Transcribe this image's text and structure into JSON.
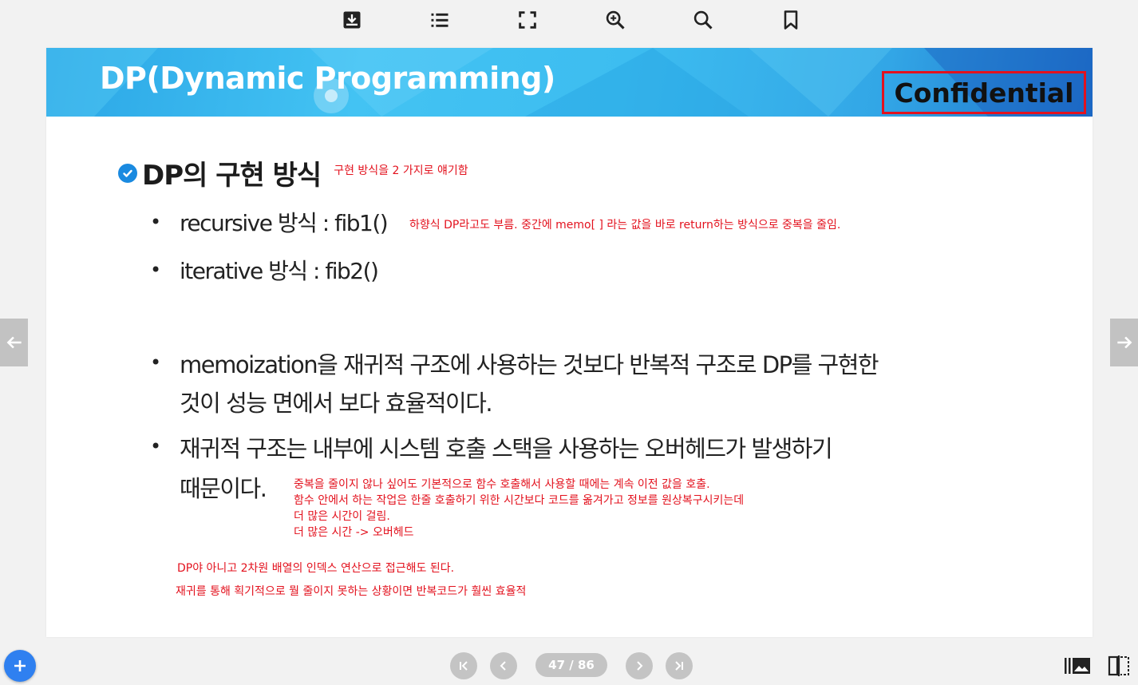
{
  "toolbar": {
    "icons": [
      "download-icon",
      "list-icon",
      "fullscreen-icon",
      "zoom-in-icon",
      "search-icon",
      "bookmark-icon"
    ]
  },
  "slide": {
    "banner_title": "DP(Dynamic Programming)",
    "confidential": "Confidential",
    "heading": "DP의 구현 방식",
    "heading_note": "구현 방식을 2 가지로 얘기함",
    "bullets": [
      {
        "text": "recursive 방식 : fib1()"
      },
      {
        "text": "iterative 방식 : fib2()"
      },
      {
        "line1": "memoization을 재귀적 구조에 사용하는 것보다 반복적 구조로 DP를 구현한",
        "line2": "것이 성능 면에서 보다 효율적이다."
      },
      {
        "line1": "재귀적 구조는 내부에 시스템 호출 스택을 사용하는 오버헤드가 발생하기",
        "line2": "때문이다."
      }
    ],
    "notes": {
      "recursive_note": "하향식 DP라고도 부름. 중간에 memo[ ] 라는 값을 바로 return하는 방식으로 중복을 줄임.",
      "overhead_lines": [
        "중복을 줄이지 않나 싶어도 기본적으로 함수 호출해서 사용할 때에는 계속 이전 값을 호출.",
        "함수 안에서 하는 작업은 한줄 호출하기 위한 시간보다 코드를 옮겨가고 정보를 원상복구시키는데",
        "더 많은 시간이 걸림.",
        "더 많은 시간 -> 오버헤드"
      ],
      "bottom_1": "DP야 아니고 2차원 배열의 인덱스 연산으로 접근해도 된다.",
      "bottom_2": "재귀를 통해 획기적으로 뭘 줄이지 못하는 상황이면 반복코드가 훨씬 효율적"
    }
  },
  "navigation": {
    "page_counter": "47 / 86",
    "current_page": 47,
    "total_pages": 86
  },
  "colors": {
    "accent_red": "#e3121e",
    "banner_blue": "#3dbdf0",
    "fab_blue": "#2f80f0"
  }
}
